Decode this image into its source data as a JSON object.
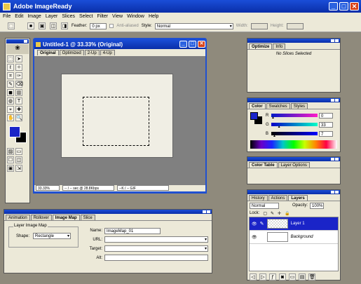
{
  "app": {
    "title": "Adobe ImageReady"
  },
  "menu": [
    "File",
    "Edit",
    "Image",
    "Layer",
    "Slices",
    "Select",
    "Filter",
    "View",
    "Window",
    "Help"
  ],
  "options": {
    "feather_label": "Feather:",
    "feather_value": "0 px",
    "antialiased": "Anti-aliased",
    "style_label": "Style:",
    "style_value": "Normal",
    "width_label": "Width:",
    "height_label": "Height:"
  },
  "doc": {
    "title": "Untitled-1 @ 33.33% (Original)",
    "tabs": [
      "Original",
      "Optimized",
      "2-Up",
      "4-Up"
    ],
    "status": [
      "33.33%",
      "-- / -- sec @ 28.8Kbps",
      "--K / -- GIF"
    ]
  },
  "optimize": {
    "tabs": [
      "Optimize",
      "Info"
    ],
    "message": "No Slices Selected"
  },
  "color": {
    "tabs": [
      "Color",
      "Swatches",
      "Styles"
    ],
    "channels": [
      {
        "label": "R",
        "value": "0"
      },
      {
        "label": "G",
        "value": "33",
        "pos": 0.13
      },
      {
        "label": "B",
        "value": "7"
      }
    ],
    "colors": {
      "fg": "#1a24c8",
      "bg": "#000000"
    }
  },
  "colortable": {
    "tabs": [
      "Color Table",
      "Layer Options"
    ]
  },
  "layers": {
    "tabs": [
      "History",
      "Actions",
      "Layers"
    ],
    "mode": "Normal",
    "opacity_label": "Opacity:",
    "opacity": "100%",
    "lock_label": "Lock:",
    "items": [
      {
        "name": "Layer 1",
        "selected": true
      },
      {
        "name": "Background",
        "selected": false
      }
    ]
  },
  "bottom": {
    "tabs": [
      "Animation",
      "Rollover",
      "Image Map",
      "Slice"
    ],
    "group_label": "Layer Image Map",
    "shape_label": "Shape:",
    "shape_value": "Rectangle",
    "name_label": "Name:",
    "name_value": "ImageMap_01",
    "url_label": "URL:",
    "target_label": "Target:",
    "alt_label": "Alt:"
  }
}
